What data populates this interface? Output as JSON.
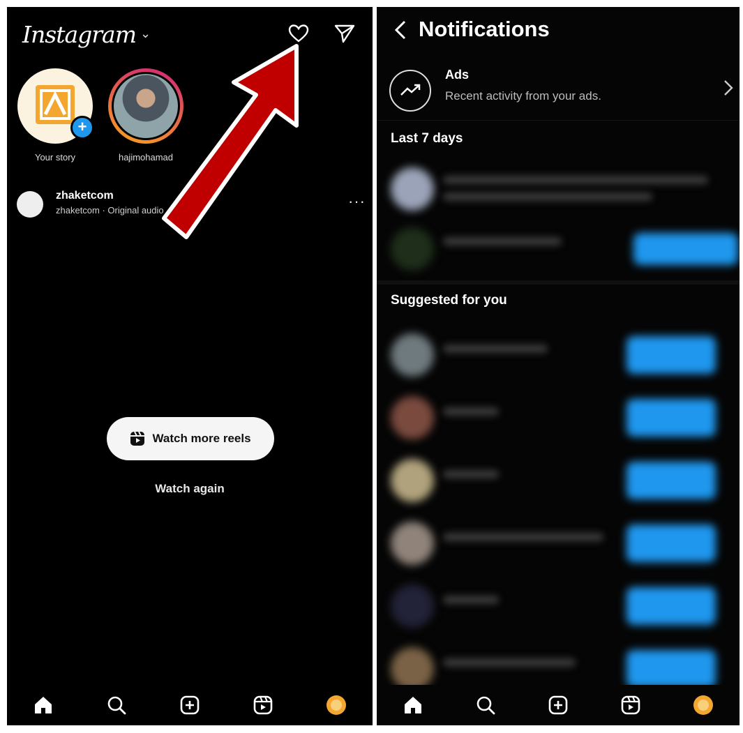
{
  "left_screen": {
    "app_title": "Instagram",
    "stories": [
      {
        "label": "Your story"
      },
      {
        "label": "hajimohamad"
      }
    ],
    "post": {
      "username": "zhaketcom",
      "subtitle": "zhaketcom · Original audio",
      "more": "···"
    },
    "watch_more_label": "Watch more reels",
    "watch_again_label": "Watch again"
  },
  "right_screen": {
    "title": "Notifications",
    "ads": {
      "title": "Ads",
      "subtitle": "Recent activity from your ads."
    },
    "section_last7": "Last 7 days",
    "section_suggested": "Suggested for you"
  },
  "colors": {
    "background": "#000000",
    "accent_blue": "#1f97ee",
    "annotation_arrow": "#c00000",
    "story_ring_start": "#f9a51c",
    "story_ring_end": "#d1227a"
  },
  "icons": [
    "heart-icon",
    "direct-message-icon",
    "home-icon",
    "search-icon",
    "create-icon",
    "reels-icon",
    "profile-avatar-icon",
    "back-chevron-icon",
    "ads-trend-icon",
    "chevron-right-icon"
  ]
}
